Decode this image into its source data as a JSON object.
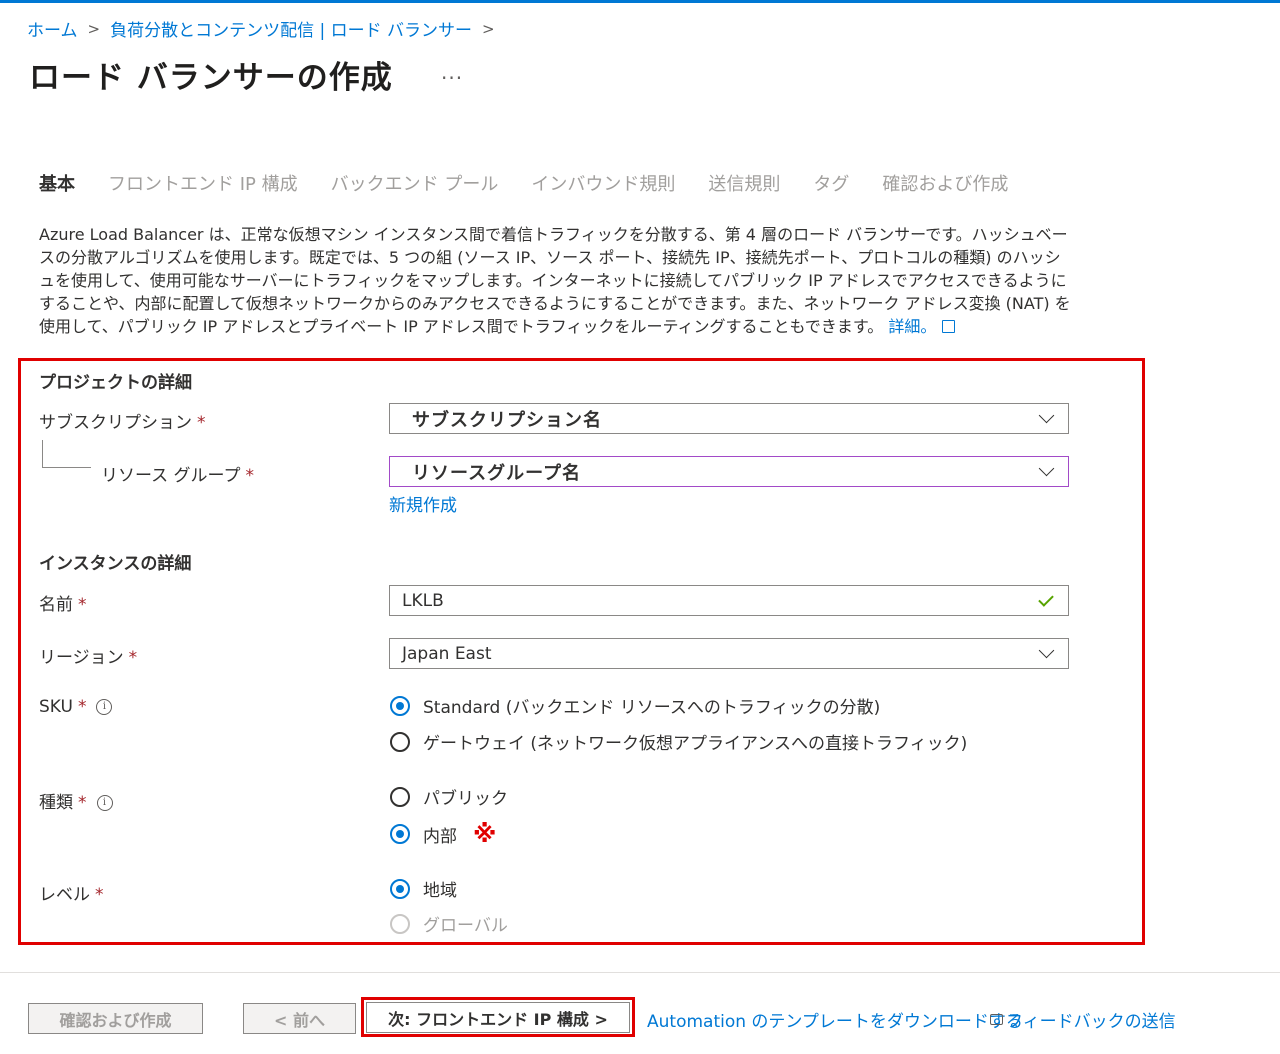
{
  "breadcrumb": {
    "home": "ホーム",
    "category": "負荷分散とコンテンツ配信 | ロード バランサー",
    "separator": ">"
  },
  "page": {
    "title": "ロード バランサーの作成",
    "more": "..."
  },
  "tabs": [
    "基本",
    "フロントエンド IP 構成",
    "バックエンド プール",
    "インバウンド規則",
    "送信規則",
    "タグ",
    "確認および作成"
  ],
  "description": {
    "text": "Azure Load Balancer は、正常な仮想マシン インスタンス間で着信トラフィックを分散する、第 4 層のロード バランサーです。ハッシュベースの分散アルゴリズムを使用します。既定では、5 つの組 (ソース IP、ソース ポート、接続先 IP、接続先ポート、プロトコルの種類) のハッシュを使用して、使用可能なサーバーにトラフィックをマップします。インターネットに接続してパブリック IP アドレスでアクセスできるようにすることや、内部に配置して仮想ネットワークからのみアクセスできるようにすることができます。また、ネットワーク アドレス変換 (NAT) を使用して、パブリック IP アドレスとプライベート IP アドレス間でトラフィックをルーティングすることもできます。",
    "link": "詳細。"
  },
  "project": {
    "heading": "プロジェクトの詳細",
    "subscription_label": "サブスクリプション",
    "subscription_value": "サブスクリプション名",
    "resource_group_label": "リソース グループ",
    "resource_group_value": "リソースグループ名",
    "new_link": "新規作成"
  },
  "instance": {
    "heading": "インスタンスの詳細",
    "name_label": "名前",
    "name_value": "LKLB",
    "region_label": "リージョン",
    "region_value": "Japan East",
    "sku_label": "SKU",
    "sku_options": [
      "Standard (バックエンド リソースへのトラフィックの分散)",
      "ゲートウェイ (ネットワーク仮想アプライアンスへの直接トラフィック)"
    ],
    "type_label": "種類",
    "type_options": [
      "パブリック",
      "内部"
    ],
    "type_note": "※",
    "tier_label": "レベル",
    "tier_options": [
      "地域",
      "グローバル"
    ]
  },
  "required_mark": "*",
  "info_glyph": "i",
  "footer": {
    "review_create": "確認および作成",
    "previous": "< 前へ",
    "next": "次: フロントエンド IP 構成 >",
    "automation": "Automation のテンプレートをダウンロードする",
    "feedback": "フィードバックの送信"
  },
  "colors": {
    "accent": "#0078d4",
    "highlight_red": "#e00000",
    "required": "#a4262c",
    "valid_check": "#57a300"
  }
}
